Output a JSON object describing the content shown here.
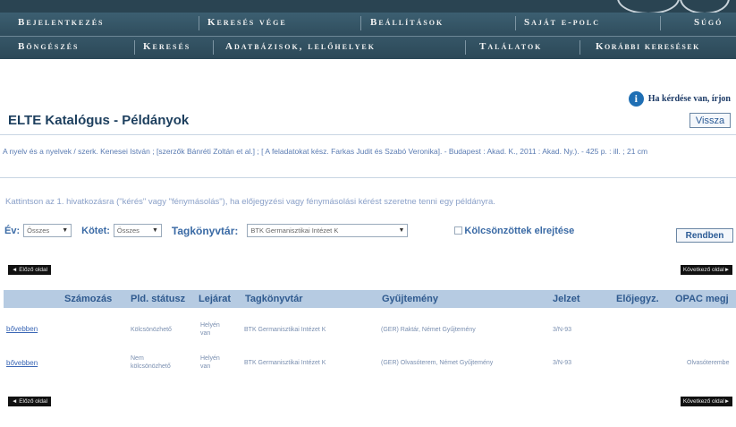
{
  "nav": {
    "row1": [
      "Bejelentkezés",
      "Keresés vége",
      "Beállítások",
      "Saját e-polc",
      "Súgó"
    ],
    "row2": [
      "Böngészés",
      "Keresés",
      "Adatbázisok, lelőhelyek",
      "Találatok",
      "Korábbi keresések"
    ]
  },
  "info": {
    "icon": "info-icon",
    "text": "Ha kérdése van, írjon"
  },
  "page": {
    "title": "ELTE Katalógus - Példányok",
    "back_label": "Vissza"
  },
  "citation": "A nyelv és a nyelvek / szerk. Kenesei István ; [szerzők Bánréti Zoltán et al.] ; [ A feladatokat kész. Farkas Judit és Szabó Veronika]. - Budapest : Akad. K., 2011 : Akad. Ny.). - 425 p. : ill. ; 21 cm",
  "instruction": "Kattintson az 1. hivatkozásra (\"kérés\" vagy \"fénymásolás\"), ha előjegyzési vagy fénymásolási kérést szeretne tenni egy példányra.",
  "filters": {
    "ev_label": "Év:",
    "ev_value": "Összes",
    "kotet_label": "Kötet:",
    "kotet_value": "Összes",
    "tagkonyvtar_label": "Tagkönyvtár:",
    "tagkonyvtar_value": "BTK Germanisztikai Intézet K",
    "hide_loaned_label": "Kölcsönzöttek elrejtése",
    "ok_label": "Rendben"
  },
  "pager": {
    "prev_label": "◄  Előző oldal",
    "next_label": "Következő oldal►"
  },
  "table": {
    "headers": [
      "Számozás",
      "Pld. státusz",
      "Lejárat",
      "Tagkönyvtár",
      "Gyűjtemény",
      "Jelzet",
      "Előjegyz.",
      "OPAC megj"
    ],
    "rows": [
      {
        "link": "bővebben",
        "status": "Kölcsönözhető",
        "due_line1": "Helyén",
        "due_line2": "van",
        "library": "BTK Germanisztikai Intézet K",
        "collection": "(GER) Raktár, Német Gyűjtemény",
        "callno": "3/N-93",
        "reservation": "",
        "opac": ""
      },
      {
        "link": "bővebben",
        "status_line1": "Nem",
        "status_line2": "kölcsönözhető",
        "due_line1": "Helyén",
        "due_line2": "van",
        "library": "BTK Germanisztikai Intézet K",
        "collection": "(GER) Olvasóterem, Német Gyűjtemény",
        "callno": "3/N-93",
        "reservation": "",
        "opac": "Olvasóterembe"
      }
    ]
  }
}
